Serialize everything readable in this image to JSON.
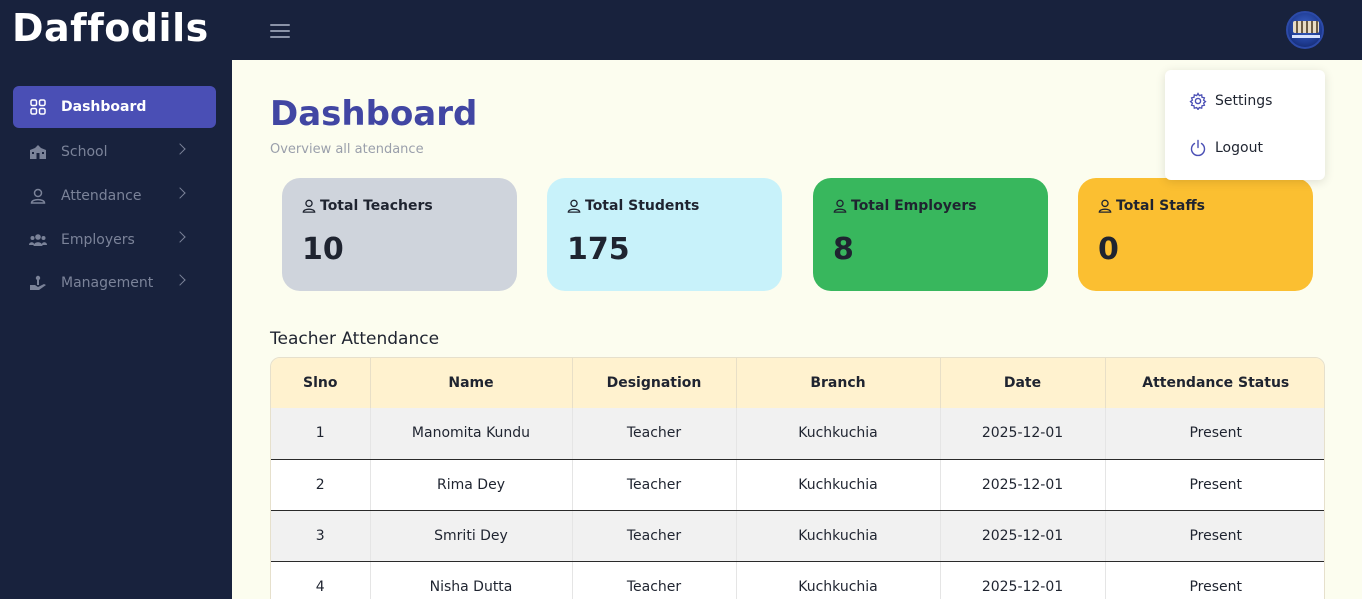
{
  "app": {
    "logo": "Daffodils"
  },
  "sidebar": {
    "items": [
      {
        "label": "Dashboard",
        "icon": "grid-icon",
        "active": true
      },
      {
        "label": "School",
        "icon": "school-icon",
        "has_submenu": true
      },
      {
        "label": "Attendance",
        "icon": "user-icon",
        "has_submenu": true
      },
      {
        "label": "Employers",
        "icon": "users-icon",
        "has_submenu": true
      },
      {
        "label": "Management",
        "icon": "hand-icon",
        "has_submenu": true
      }
    ]
  },
  "header": {
    "title": "Dashboard",
    "subtitle": "Overview all atendance"
  },
  "cards": [
    {
      "label": "Total Teachers",
      "value": "10",
      "color": "#cfd4dc"
    },
    {
      "label": "Total Students",
      "value": "175",
      "color": "#c8f2fa"
    },
    {
      "label": "Total Employers",
      "value": "8",
      "color": "#38b75d"
    },
    {
      "label": "Total Staffs",
      "value": "0",
      "color": "#fbbf31"
    }
  ],
  "attendance": {
    "title": "Teacher Attendance",
    "columns": [
      "Slno",
      "Name",
      "Designation",
      "Branch",
      "Date",
      "Attendance Status"
    ],
    "rows": [
      [
        "1",
        "Manomita Kundu",
        "Teacher",
        "Kuchkuchia",
        "2025-12-01",
        "Present"
      ],
      [
        "2",
        "Rima Dey",
        "Teacher",
        "Kuchkuchia",
        "2025-12-01",
        "Present"
      ],
      [
        "3",
        "Smriti Dey",
        "Teacher",
        "Kuchkuchia",
        "2025-12-01",
        "Present"
      ],
      [
        "4",
        "Nisha Dutta",
        "Teacher",
        "Kuchkuchia",
        "2025-12-01",
        "Present"
      ]
    ]
  },
  "user_menu": {
    "items": [
      {
        "label": "Settings",
        "icon": "gear-icon"
      },
      {
        "label": "Logout",
        "icon": "power-icon"
      }
    ]
  },
  "colors": {
    "accent": "#4a4fb5",
    "sidebar_bg": "#18223d",
    "page_bg": "#fcfdef",
    "title": "#4146a3"
  }
}
